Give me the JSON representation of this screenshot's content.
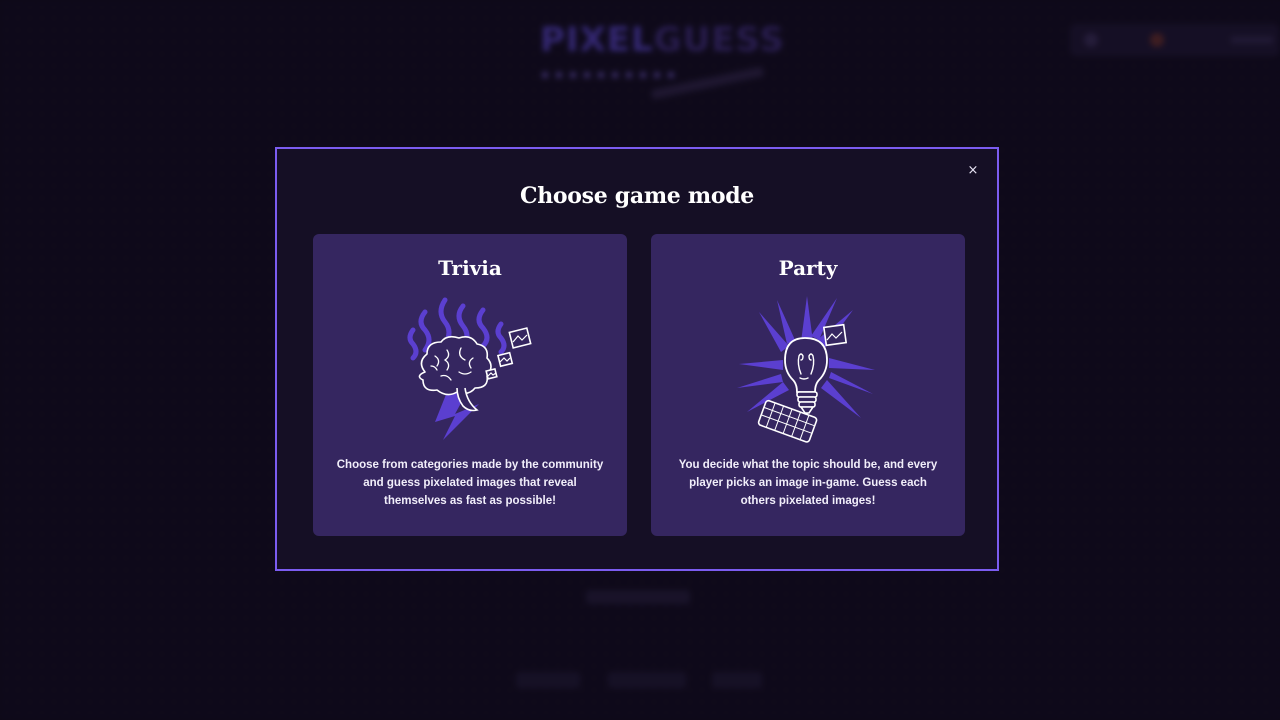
{
  "modal": {
    "title": "Choose game mode",
    "close_glyph": "×",
    "border_color": "#7b5cf0"
  },
  "modes": [
    {
      "title": "Trivia",
      "description": "Choose from categories made by the community and guess pixelated images that reveal themselves as fast as possible!",
      "icon": "brain-lightning-icon"
    },
    {
      "title": "Party",
      "description": "You decide what the topic should be, and every player picks an image in-game. Guess each others pixelated images!",
      "icon": "lightbulb-keyboard-icon"
    }
  ],
  "colors": {
    "card_bg": "#352660",
    "modal_bg": "#150f25",
    "accent_purple": "#5b3fd0"
  }
}
